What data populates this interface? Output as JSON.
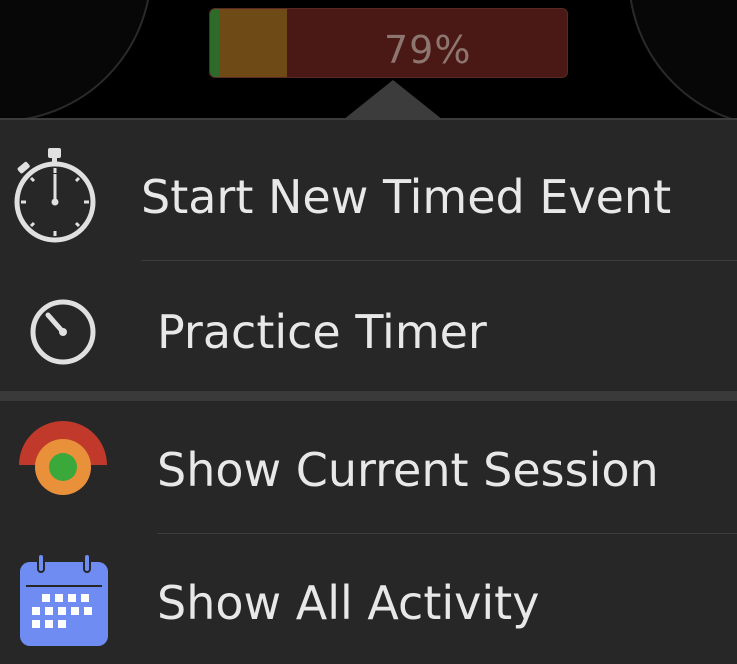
{
  "progress": {
    "percent_label": "79%",
    "value": 79,
    "segments": [
      {
        "color": "#2e6a2a"
      },
      {
        "color": "#6e4a16"
      },
      {
        "color": "#4a1815"
      }
    ]
  },
  "menu": {
    "items": [
      {
        "label": "Start New Timed Event",
        "icon": "stopwatch-icon"
      },
      {
        "label": "Practice Timer",
        "icon": "timer-icon"
      },
      {
        "label": "Show Current Session",
        "icon": "session-gauge-icon"
      },
      {
        "label": "Show All Activity",
        "icon": "calendar-icon"
      }
    ]
  },
  "colors": {
    "menu_background": "#272727",
    "text": "#e8e8e8",
    "calendar_blue": "#6e8cf2",
    "session_red": "#c0392b",
    "session_orange": "#e8913a",
    "session_green": "#3aa83a"
  }
}
